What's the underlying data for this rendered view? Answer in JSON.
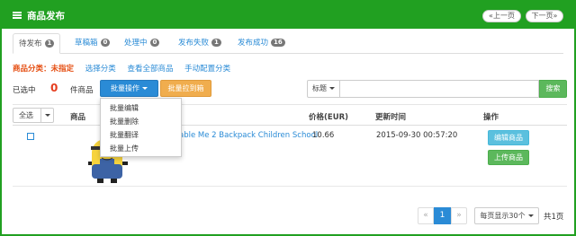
{
  "header": {
    "title": "商品发布",
    "prev_label": "«上一页",
    "next_label": "下一页»"
  },
  "tabs": [
    {
      "label": "待发布",
      "count": "1"
    },
    {
      "label": "草稿箱",
      "count": "0"
    },
    {
      "label": "处理中",
      "count": "0"
    },
    {
      "label": "发布失败",
      "count": "1"
    },
    {
      "label": "发布成功",
      "count": "16"
    }
  ],
  "category": {
    "label": "商品分类：未指定",
    "links": [
      "选择分类",
      "查看全部商品",
      "手动配置分类"
    ]
  },
  "selection": {
    "prefix": "已选中",
    "count": "0",
    "suffix": "件商品",
    "batch_ops_label": "批量操作",
    "batch_draft_label": "批量拉到箱",
    "search_field_label": "标题",
    "search_value": "",
    "search_button": "搜索"
  },
  "batch_menu": [
    "批量编辑",
    "批量删除",
    "批量翻译",
    "批量上传"
  ],
  "table": {
    "select_all_label": "全选",
    "headers": [
      "商品",
      "价格(EUR)",
      "更新时间",
      "操作"
    ],
    "rows": [
      {
        "title": "able Me 2 Backpack Children School",
        "price": "10.66",
        "updated": "2015-09-30 00:57:20",
        "edit_label": "编辑商品",
        "upload_label": "上传商品"
      }
    ]
  },
  "pagination": {
    "prev": "«",
    "current_page": "1",
    "next": "»",
    "per_page_label": "每页显示30个",
    "total_label": "共1页"
  },
  "colors": {
    "header_green": "#21a021",
    "primary_blue": "#2a8bd6",
    "warning_orange": "#f0ad4e",
    "success_green": "#5cb85c",
    "category_red": "#e54d10",
    "selected_count_red": "#e53d1e"
  }
}
